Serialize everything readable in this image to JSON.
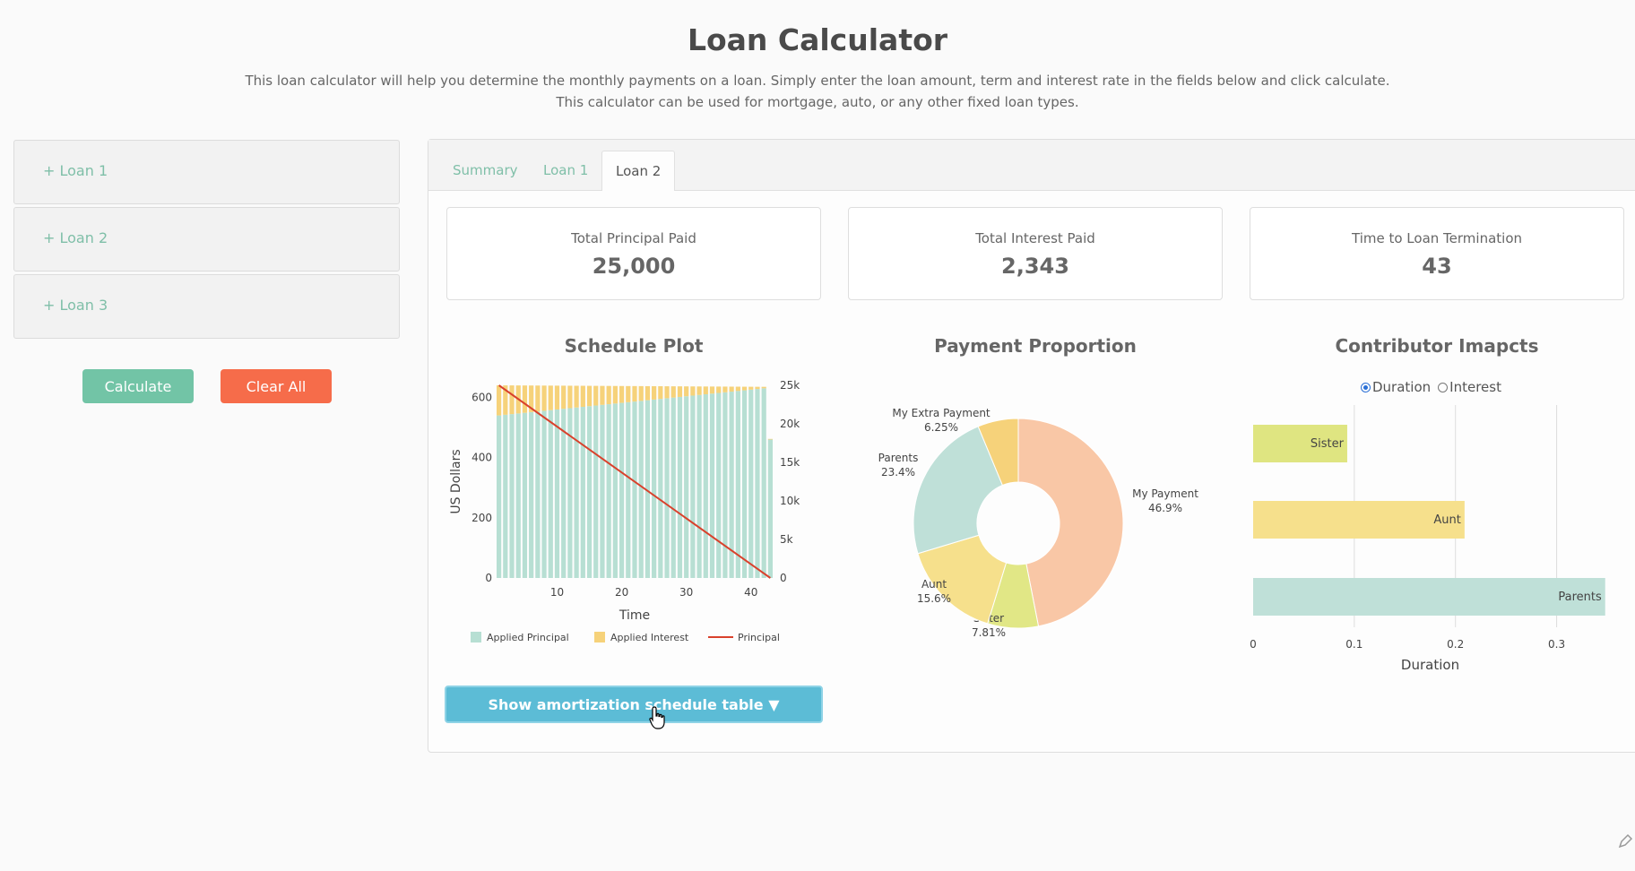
{
  "header": {
    "title": "Loan Calculator",
    "subtitle_line1": "This loan calculator will help you determine the monthly payments on a loan. Simply enter the loan amount, term and interest rate in the fields below and click calculate.",
    "subtitle_line2": "This calculator can be used for mortgage, auto, or any other fixed loan types."
  },
  "sidebar": {
    "loans": [
      "+ Loan 1",
      "+ Loan 2",
      "+ Loan 3"
    ],
    "calculate_label": "Calculate",
    "clear_label": "Clear All"
  },
  "tabs": [
    {
      "label": "Summary",
      "active": false
    },
    {
      "label": "Loan 1",
      "active": false
    },
    {
      "label": "Loan 2",
      "active": true
    }
  ],
  "stats": [
    {
      "label": "Total Principal Paid",
      "value": "25,000"
    },
    {
      "label": "Total Interest Paid",
      "value": "2,343"
    },
    {
      "label": "Time to Loan Termination",
      "value": "43"
    }
  ],
  "colors": {
    "accent_green": "#72c4a6",
    "danger": "#f66c4a",
    "principal_bar": "#b7dfd3",
    "interest_bar": "#f6d27a",
    "principal_line": "#d9412c",
    "amort_button": "#5cbcd6"
  },
  "amort_button_label": "Show amortization schedule table ▼",
  "chart_data": [
    {
      "type": "bar",
      "title": "Schedule Plot",
      "xlabel": "Time",
      "ylabel": "US Dollars",
      "stacked": true,
      "x_range": [
        1,
        43
      ],
      "x_ticks": [
        10,
        20,
        30,
        40
      ],
      "y_ticks": [
        0,
        200,
        400,
        600
      ],
      "ylim": [
        0,
        640
      ],
      "y2_ticks": [
        "0",
        "5k",
        "10k",
        "15k",
        "20k",
        "25k"
      ],
      "y2lim": [
        0,
        25000
      ],
      "series": [
        {
          "name": "Applied Principal",
          "kind": "bar",
          "start": 540,
          "end": 630,
          "last": 460
        },
        {
          "name": "Applied Interest",
          "kind": "bar",
          "start": 100,
          "end": 5,
          "last": 2
        },
        {
          "name": "Principal",
          "kind": "line",
          "start": 25000,
          "end": 0
        }
      ],
      "legend": "bottom"
    },
    {
      "type": "pie",
      "title": "Payment Proportion",
      "hole": true,
      "slices": [
        {
          "label": "My Payment",
          "pct": "46.9%",
          "value": 46.9,
          "color": "#f9c7a6"
        },
        {
          "label": "Sister",
          "pct": "7.81%",
          "value": 7.81,
          "color": "#e1e786"
        },
        {
          "label": "Aunt",
          "pct": "15.6%",
          "value": 15.6,
          "color": "#f6e08c"
        },
        {
          "label": "Parents",
          "pct": "23.4%",
          "value": 23.4,
          "color": "#bfe0d8"
        },
        {
          "label": "My Extra Payment",
          "pct": "6.25%",
          "value": 6.25,
          "color": "#f6d27a"
        }
      ]
    },
    {
      "type": "bar",
      "orientation": "horizontal",
      "title": "Contributor Imapcts",
      "xlabel": "Duration",
      "x_ticks": [
        "0",
        "0.1",
        "0.2",
        "0.3"
      ],
      "xlim": [
        0,
        0.35
      ],
      "categories": [
        "Sister",
        "Aunt",
        "Parents"
      ],
      "values": [
        0.093,
        0.209,
        0.348
      ],
      "colors": [
        "#dfe581",
        "#f6e08c",
        "#bfe0d8"
      ],
      "radio_options": [
        {
          "label": "Duration",
          "checked": true
        },
        {
          "label": "Interest",
          "checked": false
        }
      ]
    }
  ]
}
